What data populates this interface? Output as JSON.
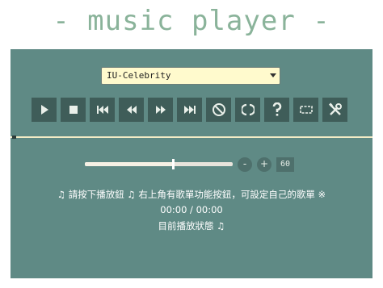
{
  "app": {
    "title": "- music player -"
  },
  "playlist": {
    "selected": "IU-Celebrity"
  },
  "controls": [
    {
      "name": "play-button",
      "icon": "play-icon"
    },
    {
      "name": "stop-button",
      "icon": "stop-icon"
    },
    {
      "name": "previous-track-button",
      "icon": "skip-previous-icon"
    },
    {
      "name": "rewind-button",
      "icon": "rewind-icon"
    },
    {
      "name": "fast-forward-button",
      "icon": "fast-forward-icon"
    },
    {
      "name": "next-track-button",
      "icon": "skip-next-icon"
    },
    {
      "name": "disable-button",
      "icon": "ban-icon"
    },
    {
      "name": "loop-button",
      "icon": "loop-icon"
    },
    {
      "name": "help-button",
      "icon": "question-icon"
    },
    {
      "name": "shuffle-button",
      "icon": "shuffle-box-icon"
    },
    {
      "name": "settings-button",
      "icon": "tools-icon"
    }
  ],
  "progress": {
    "fraction": 0.0
  },
  "volume": {
    "minus_label": "-",
    "plus_label": "+",
    "value": "60",
    "fraction": 0.6
  },
  "info": {
    "message": "♫ 請按下播放鈕 ♫ 右上角有歌單功能按鈕，可設定自己的歌單 ※",
    "time": "00:00 / 00:00",
    "status": "目前播放狀態 ♫"
  },
  "colors": {
    "title": "#8ab39a",
    "panel": "#5f8a85",
    "button": "#3f5d59",
    "select_bg": "#fffacd"
  }
}
